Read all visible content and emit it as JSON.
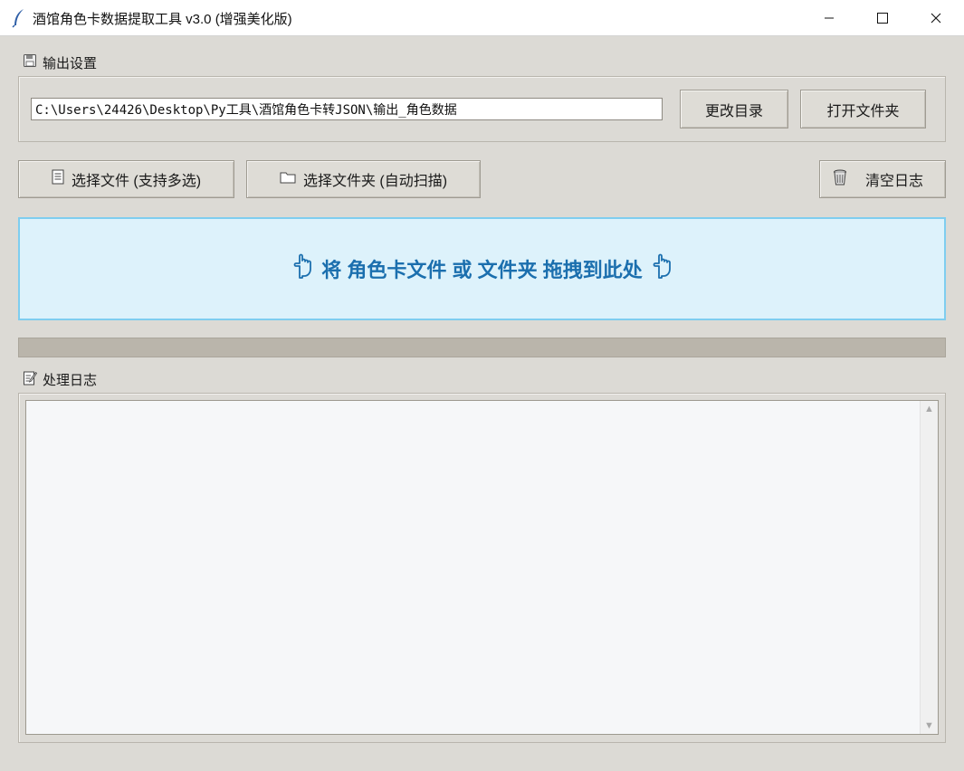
{
  "window": {
    "title": "酒馆角色卡数据提取工具 v3.0 (增强美化版)",
    "icon": "feather-icon",
    "controls": [
      "minimize",
      "maximize",
      "close"
    ]
  },
  "output_settings": {
    "label": "输出设置",
    "icon": "save-icon",
    "path_value": "C:\\Users\\24426\\Desktop\\Py工具\\酒馆角色卡转JSON\\输出_角色数据",
    "change_dir_label": "更改目录",
    "open_folder_label": "打开文件夹"
  },
  "actions": {
    "select_files_label": "选择文件 (支持多选)",
    "select_files_icon": "document-icon",
    "select_folder_label": "选择文件夹 (自动扫描)",
    "select_folder_icon": "folder-icon",
    "clear_log_label": "清空日志",
    "clear_log_icon": "trash-icon"
  },
  "drop_zone": {
    "text": "将 角色卡文件 或 文件夹 拖拽到此处",
    "icon": "pointing-down-hand-icon",
    "background": "#ddf2fb",
    "border": "#7fcdef",
    "text_color": "#1b6fae"
  },
  "progress": {
    "value": 0
  },
  "log": {
    "label": "处理日志",
    "icon": "memo-icon",
    "content": ""
  },
  "colors": {
    "window_bg": "#dcdad5",
    "titlebar_bg": "#ffffff",
    "progress_trough": "#bab5ab",
    "log_bg": "#f6f7f9"
  }
}
